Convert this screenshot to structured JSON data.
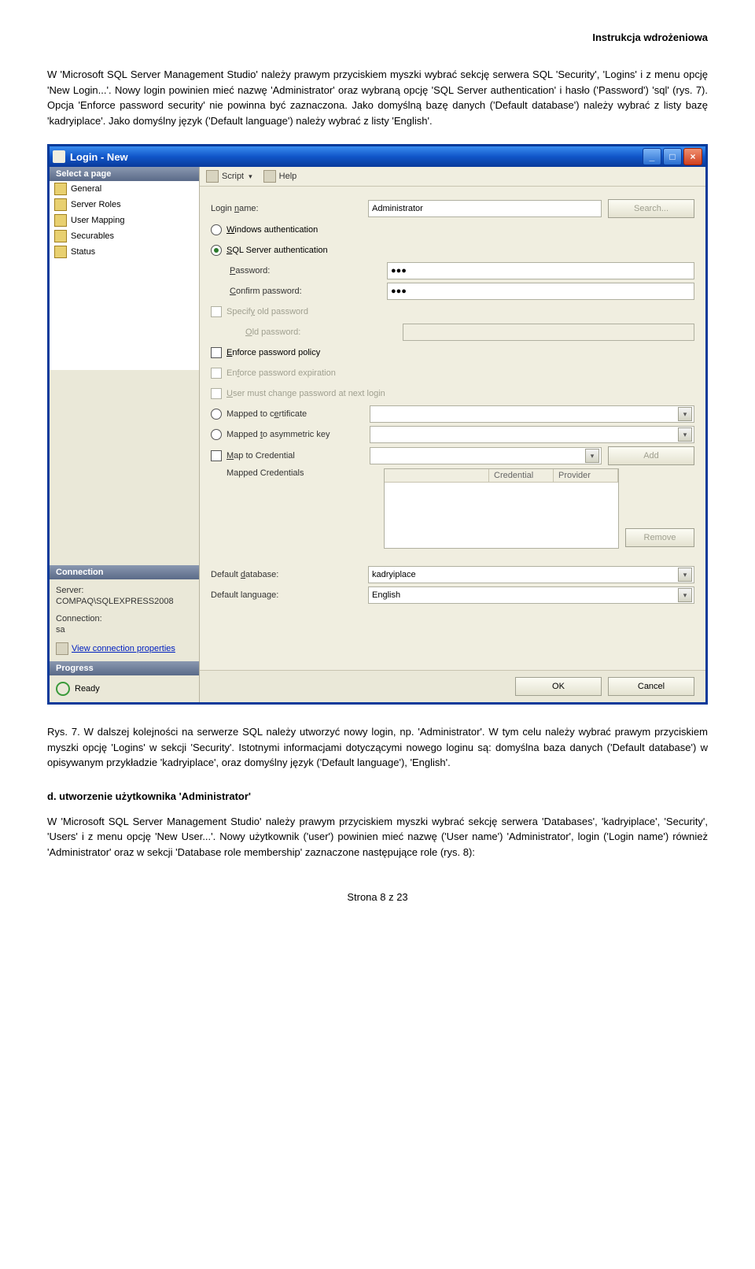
{
  "header": {
    "title": "Instrukcja wdrożeniowa"
  },
  "para1": "W 'Microsoft SQL Server Management Studio' należy prawym przyciskiem myszki wybrać sekcję serwera SQL 'Security', 'Logins' i z menu opcję 'New Login...'. Nowy login powinien mieć nazwę 'Administrator' oraz wybraną opcję 'SQL Server authentication' i hasło ('Password') 'sql' (rys. 7). Opcja 'Enforce password security' nie powinna być zaznaczona. Jako domyślną bazę danych ('Default database') należy wybrać z listy bazę 'kadryiplace'. Jako domyślny język ('Default language') należy wybrać z listy 'English'.",
  "window": {
    "title": "Login - New",
    "pane_header_pages": "Select a page",
    "pages": [
      "General",
      "Server Roles",
      "User Mapping",
      "Securables",
      "Status"
    ],
    "pane_header_conn": "Connection",
    "conn": {
      "server_label": "Server:",
      "server_value": "COMPAQ\\SQLEXPRESS2008",
      "connection_label": "Connection:",
      "connection_value": "sa",
      "view_link": "View connection properties"
    },
    "pane_header_prog": "Progress",
    "progress": {
      "status": "Ready"
    },
    "toolbar": {
      "script": "Script",
      "help": "Help"
    },
    "form": {
      "login_name_label": "Login name:",
      "login_name_value": "Administrator",
      "search_btn": "Search...",
      "windows_auth": "Windows authentication",
      "sql_auth": "SQL Server authentication",
      "password_label": "Password:",
      "password_value": "●●●",
      "confirm_label": "Confirm password:",
      "confirm_value": "●●●",
      "specify_old": "Specify old password",
      "old_password_label": "Old password:",
      "enforce_policy": "Enforce password policy",
      "enforce_exp": "Enforce password expiration",
      "must_change": "User must change password at next login",
      "mapped_cert": "Mapped to certificate",
      "mapped_asym": "Mapped to asymmetric key",
      "map_cred": "Map to Credential",
      "add_btn": "Add",
      "mapped_creds_label": "Mapped Credentials",
      "cred_col1": "Credential",
      "cred_col2": "Provider",
      "remove_btn": "Remove",
      "default_db_label": "Default database:",
      "default_db_value": "kadryiplace",
      "default_lang_label": "Default language:",
      "default_lang_value": "English"
    },
    "bottom": {
      "ok": "OK",
      "cancel": "Cancel"
    }
  },
  "para2": "Rys. 7. W dalszej kolejności na serwerze SQL należy utworzyć nowy login, np. 'Administrator'. W tym celu należy wybrać prawym przyciskiem myszki opcję 'Logins' w sekcji 'Security'. Istotnymi informacjami dotyczącymi nowego loginu są: domyślna baza danych ('Default database') w opisywanym przykładzie 'kadryiplace', oraz domyślny język ('Default language'), 'English'.",
  "section_d": "d. utworzenie użytkownika 'Administrator'",
  "para3": "W 'Microsoft SQL Server Management Studio' należy prawym przyciskiem myszki wybrać sekcję serwera 'Databases', 'kadryiplace', 'Security', 'Users' i z menu opcję 'New User...'. Nowy użytkownik ('user') powinien mieć nazwę ('User name') 'Administrator', login ('Login name') również 'Administrator' oraz w sekcji 'Database role membership' zaznaczone następujące role (rys. 8):",
  "footer": "Strona 8 z 23"
}
